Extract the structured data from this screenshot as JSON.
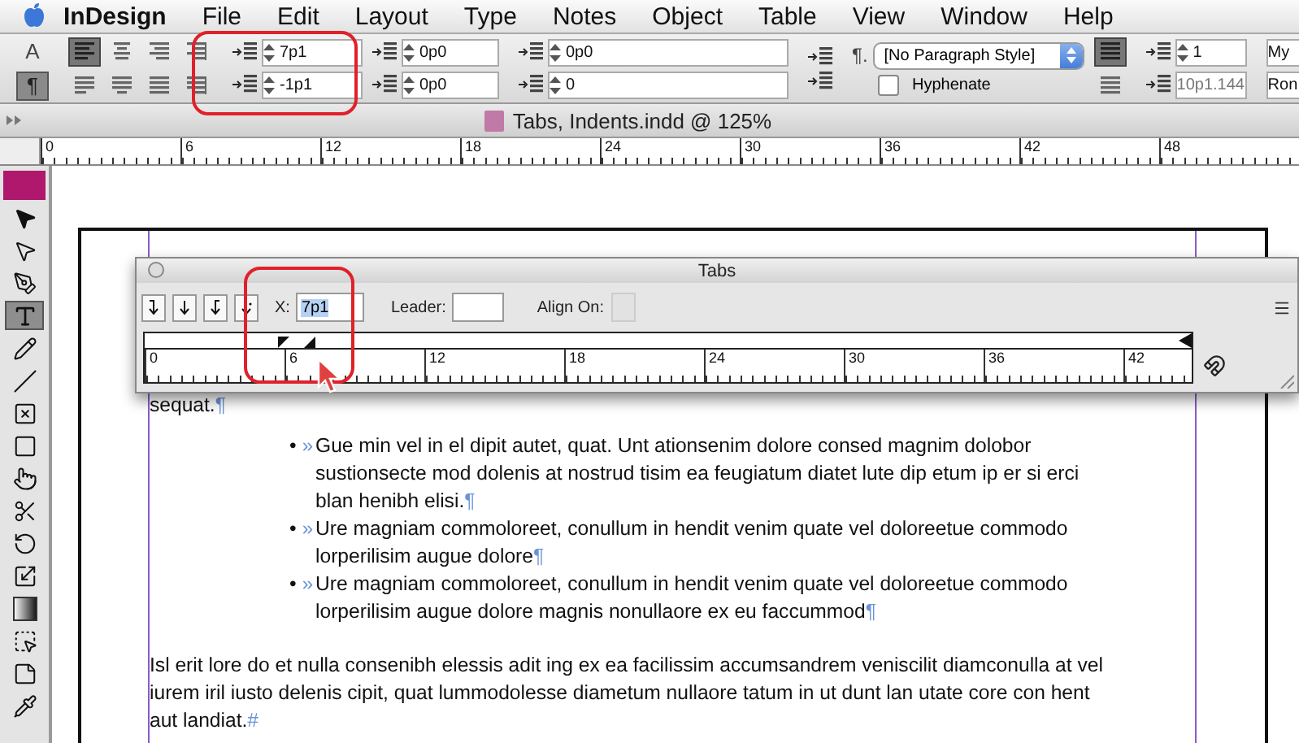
{
  "menu_bar": {
    "app": "InDesign",
    "items": [
      "File",
      "Edit",
      "Layout",
      "Type",
      "Notes",
      "Object",
      "Table",
      "View",
      "Window",
      "Help"
    ]
  },
  "control_panel": {
    "mode_buttons": [
      {
        "label": "A",
        "selected": false
      },
      {
        "label": "¶",
        "selected": true
      }
    ],
    "align_buttons": [
      {
        "kind": "left",
        "selected": true
      },
      {
        "kind": "center",
        "selected": false
      },
      {
        "kind": "right",
        "selected": false
      },
      {
        "kind": "spine",
        "selected": false
      },
      {
        "kind": "justify-left",
        "selected": false
      },
      {
        "kind": "justify-center",
        "selected": false
      },
      {
        "kind": "justify-all",
        "selected": false
      },
      {
        "kind": "justify-away",
        "selected": false
      }
    ],
    "left_indent": "7p1",
    "first_line_indent": "-1p1",
    "right_indent": "0p0",
    "last_line_indent": "0p0",
    "space_before": "0p0",
    "drop_cap_lines": "0",
    "paragraph_style_marker": "¶.",
    "paragraph_style": "[No Paragraph Style]",
    "hyphenate": {
      "label": "Hyphenate",
      "checked": false
    },
    "columns": "1",
    "gutter": "10p1.144",
    "font_field": "My",
    "style_field": "Ron"
  },
  "document": {
    "title": "Tabs, Indents.indd @ 125%",
    "ruler": [
      "0",
      "6",
      "12",
      "18",
      "24",
      "30",
      "36",
      "42",
      "48"
    ]
  },
  "tools": [
    {
      "kind": "selection",
      "selected": false
    },
    {
      "kind": "direct-selection",
      "selected": false
    },
    {
      "kind": "pen",
      "selected": false
    },
    {
      "kind": "type",
      "selected": true
    },
    {
      "kind": "pencil",
      "selected": false
    },
    {
      "kind": "line",
      "selected": false
    },
    {
      "kind": "frame",
      "selected": false
    },
    {
      "kind": "rectangle",
      "selected": false
    },
    {
      "kind": "button",
      "selected": false
    },
    {
      "kind": "scissors",
      "selected": false
    },
    {
      "kind": "rotate",
      "selected": false
    },
    {
      "kind": "scale",
      "selected": false
    },
    {
      "kind": "gradient",
      "selected": false
    },
    {
      "kind": "free-transform",
      "selected": false
    },
    {
      "kind": "note",
      "selected": false
    },
    {
      "kind": "eyedropper",
      "selected": false
    }
  ],
  "tabs_panel": {
    "title": "Tabs",
    "x_label": "X:",
    "x_value": "7p1",
    "leader_label": "Leader:",
    "align_on_label": "Align On:",
    "align_on_disabled": true,
    "ruler": [
      "0",
      "6",
      "12",
      "18",
      "24",
      "30",
      "36",
      "42"
    ]
  },
  "story": [
    {
      "kind": "body",
      "lines": [
        "sequat."
      ],
      "end_mark": "¶"
    },
    {
      "kind": "bullet",
      "bullet": "•",
      "tab_mark": "»",
      "lines": [
        "Gue min vel in el dipit autet, quat. Unt ationsenim dolore consed magnim dolobor",
        "sustionsecte mod dolenis at nostrud tisim ea feugiatum diatet lute dip etum ip er si erci",
        "blan henibh elisi."
      ],
      "end_mark": "¶"
    },
    {
      "kind": "bullet",
      "bullet": "•",
      "tab_mark": "»",
      "lines": [
        "Ure magniam commoloreet, conullum in hendit venim quate vel doloreetue commodo",
        "lorperilisim augue dolore"
      ],
      "end_mark": "¶"
    },
    {
      "kind": "bullet",
      "bullet": "•",
      "tab_mark": "»",
      "lines": [
        "Ure magniam commoloreet, conullum in hendit venim quate vel doloreetue commodo",
        "lorperilisim augue dolore magnis nonullaore ex eu faccummod"
      ],
      "end_mark": "¶"
    },
    {
      "kind": "body",
      "lines": [
        "Isl erit lore do et nulla consenibh elessis adit ing ex ea facilissim accumsandrem veniscilit diamconulla at vel",
        "iurem iril iusto delenis cipit, quat lummodolesse diametum nullaore tatum in ut dunt lan utate core con hent",
        "aut landiat."
      ],
      "end_mark": "#"
    }
  ]
}
